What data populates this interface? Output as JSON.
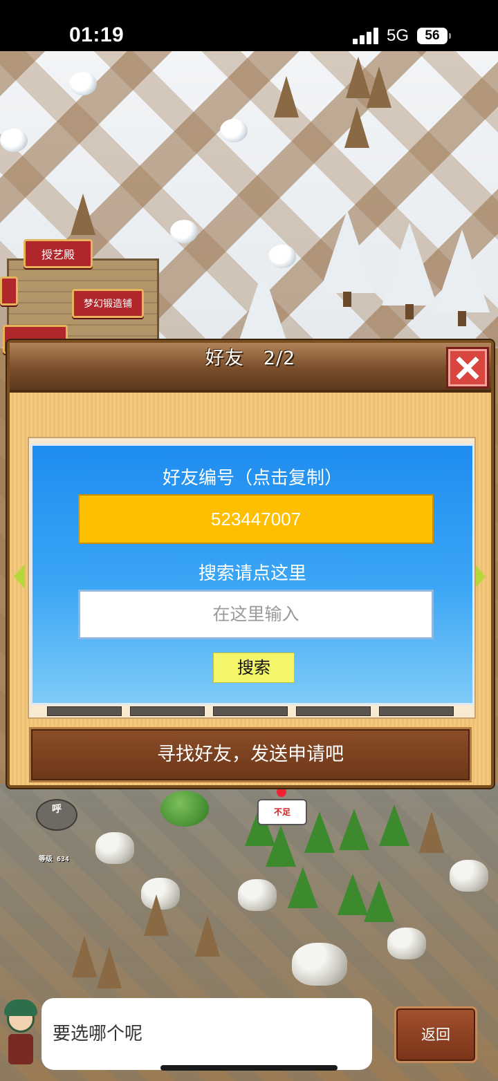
{
  "status_bar": {
    "time": "01:19",
    "network": "5G",
    "battery": "56"
  },
  "scene": {
    "buildings": [
      {
        "label": "授艺殿"
      },
      {
        "label": "梦幻锻造铺"
      },
      {
        "label": ""
      },
      {
        "label": ""
      }
    ],
    "status_tag": "不足",
    "shout": "呼",
    "level_tag": "等级 634"
  },
  "dialog": {
    "title": "好友　2/2",
    "friend_id_label": "好友编号（点击复制）",
    "friend_id": "523447007",
    "search_label": "搜索请点这里",
    "search_placeholder": "在这里输入",
    "search_button": "搜索",
    "banner": "寻找好友，发送申请吧"
  },
  "bottom": {
    "speech": "要选哪个呢",
    "back_label": "返回"
  },
  "colors": {
    "panel_blue": "#1f8df0",
    "id_button": "#fdbf00",
    "search_button": "#f5f56a",
    "close_red": "#d9453f"
  }
}
